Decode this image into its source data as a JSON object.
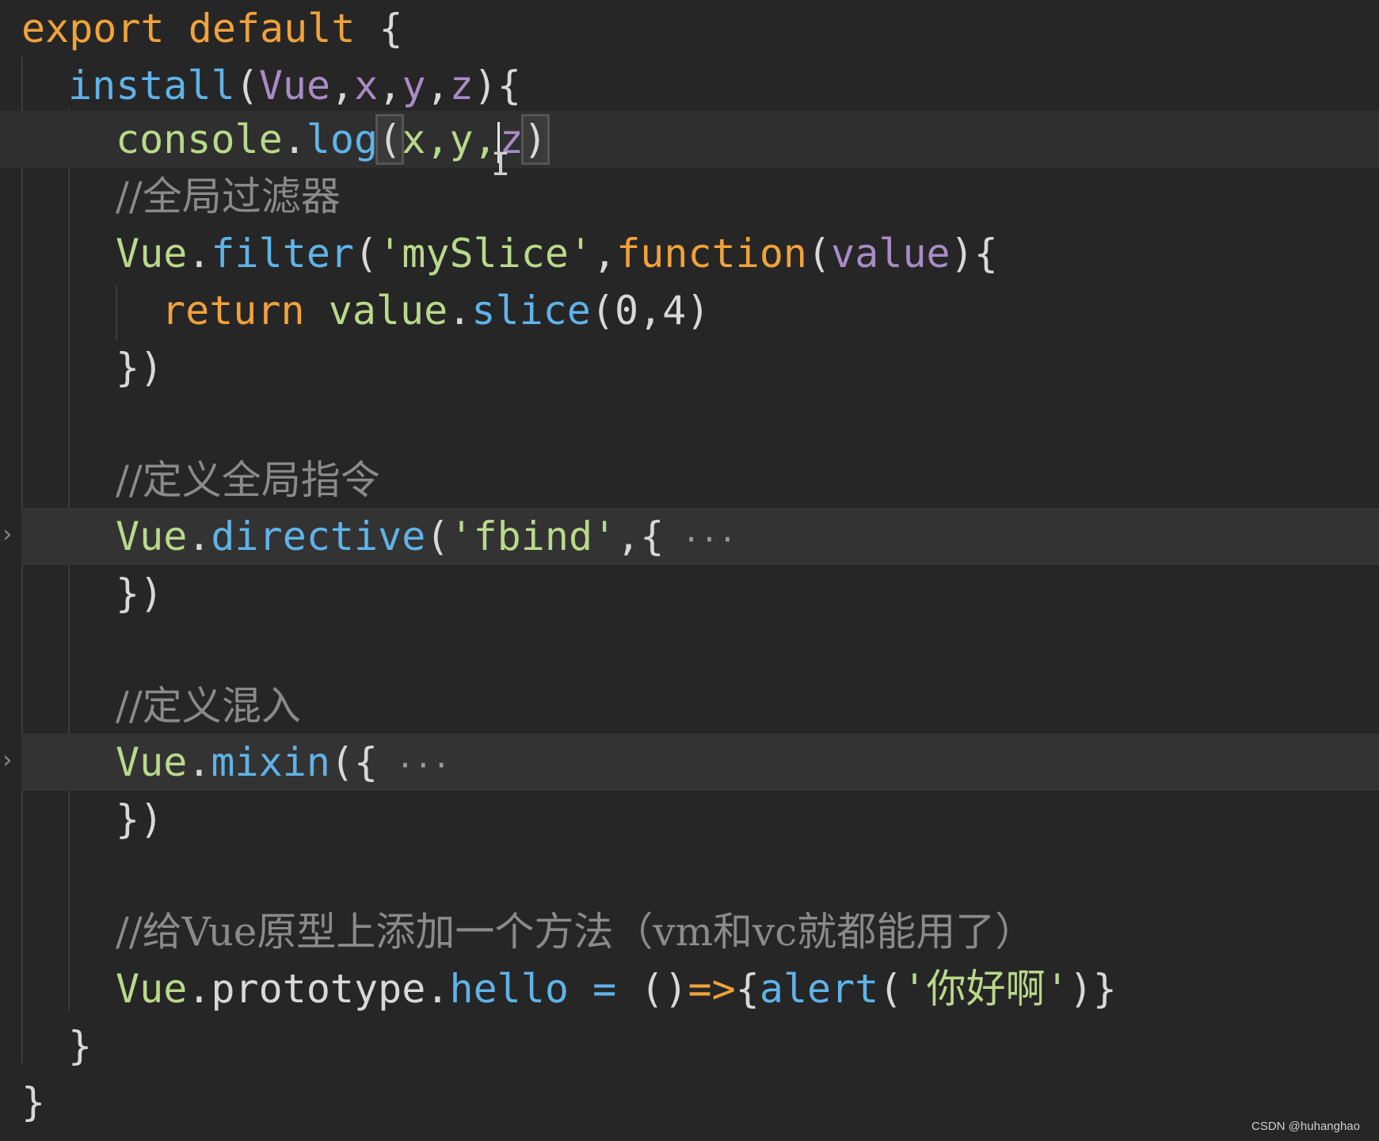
{
  "code": {
    "l1": {
      "export": "export",
      "default": "default",
      "brace": " {"
    },
    "l2": {
      "install": "install",
      "open": "(",
      "vue": "Vue",
      "c1": ",",
      "x": "x",
      "c2": ",",
      "y": "y",
      "c3": ",",
      "z": "z",
      "close": "){"
    },
    "l3": {
      "console": "console",
      "dot": ".",
      "log": "log",
      "open": "(",
      "args1": "x,y,",
      "z": "z",
      "close": ")"
    },
    "l4": {
      "comment": "//全局过滤器"
    },
    "l5": {
      "vue": "Vue",
      "dot": ".",
      "filter": "filter",
      "open": "(",
      "str": "'mySlice'",
      "comma": ",",
      "function": "function",
      "p_open": "(",
      "value": "value",
      "p_close": "){"
    },
    "l6": {
      "return": "return",
      "value": " value",
      "dot": ".",
      "slice": "slice",
      "args": "(0,4)"
    },
    "l7": {
      "close": "})"
    },
    "l8": {
      "comment": "//定义全局指令"
    },
    "l9": {
      "vue": "Vue",
      "dot": ".",
      "directive": "directive",
      "open": "(",
      "str": "'fbind'",
      "rest": ",{",
      "ellipsis": " ···"
    },
    "l10": {
      "close": "})"
    },
    "l11": {
      "comment": "//定义混入"
    },
    "l12": {
      "vue": "Vue",
      "dot": ".",
      "mixin": "mixin",
      "open": "({",
      "ellipsis": " ···"
    },
    "l13": {
      "close": "})"
    },
    "l14": {
      "comment": "//给Vue原型上添加一个方法（vm和vc就都能用了）"
    },
    "l15": {
      "vue": "Vue",
      "dot1": ".",
      "prototype": "prototype",
      "dot2": ".",
      "hello": "hello",
      "eq": " = ",
      "parens": "()",
      "arrow": "=>",
      "brace": "{",
      "alert": "alert",
      "open": "(",
      "str": "'你好啊'",
      "close": ")}"
    },
    "l16": {
      "close": "}"
    },
    "l17": {
      "close": "}"
    }
  },
  "watermark": "CSDN @huhanghao",
  "colors": {
    "background": "#262626",
    "keyword": "#f0a23b",
    "function": "#5fb3e8",
    "string": "#b9d98a",
    "parameter": "#a98cc6",
    "comment": "#8a8a8a"
  },
  "icons": {
    "fold": "chevron-right-icon",
    "cursor": "text-ibeam-icon"
  }
}
